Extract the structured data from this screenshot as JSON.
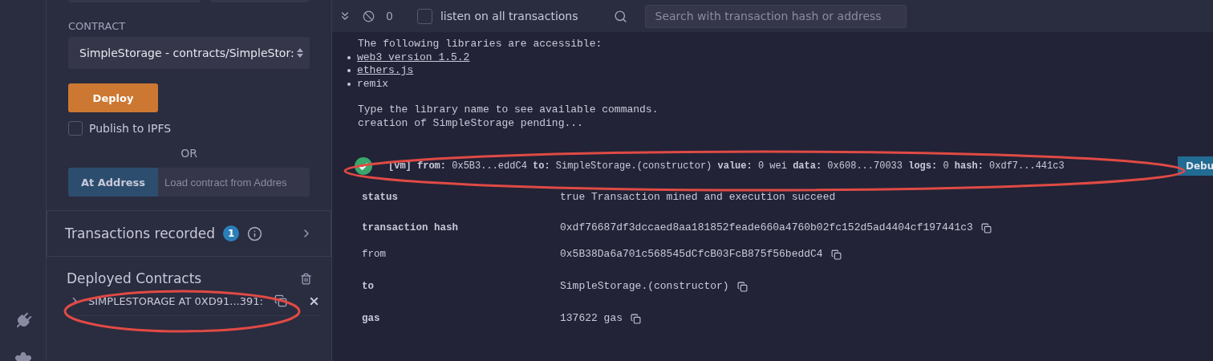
{
  "panel": {
    "contract_label": "CONTRACT",
    "contract_select": "SimpleStorage - contracts/SimpleStor:",
    "deploy_button": "Deploy",
    "publish_checkbox": {
      "label": "Publish to IPFS",
      "checked": false
    },
    "or_label": "OR",
    "at_address_button": "At Address",
    "address_field": {
      "placeholder": "Load contract from Addres"
    },
    "transactions": {
      "title": "Transactions recorded",
      "count": "1"
    },
    "deployed": {
      "title": "Deployed Contracts",
      "instances": [
        {
          "name": "SIMPLESTORAGE AT 0XD91...391:",
          "expanded": false
        }
      ]
    }
  },
  "terminal": {
    "toolbar": {
      "count": "0",
      "listen_checkbox": {
        "label": "listen on all transactions",
        "checked": false
      },
      "search": {
        "placeholder": "Search with transaction hash or address"
      }
    },
    "intro": "The following libraries are accessible:",
    "libraries": [
      {
        "name": "web3 version 1.5.2",
        "link": true
      },
      {
        "name": "ethers.js",
        "link": true
      },
      {
        "name": "remix",
        "link": false
      }
    ],
    "lines": [
      "Type the library name to see available commands.",
      "creation of SimpleStorage pending..."
    ],
    "transaction": {
      "summary": "**[vm]** **from:** 0x5B3...eddC4 **to:** SimpleStorage.(constructor) **value:** 0 wei **data:** 0x608...70033 **logs:** 0 **hash:** 0xdf7...441c3",
      "debug_button": "Debu",
      "details": [
        {
          "key": "status",
          "value": "true Transaction mined and execution succeed",
          "bold": true,
          "copyable": false
        },
        {
          "key": "transaction hash",
          "value": "0xdf76687df3dccaed8aa181852feade660a4760b02fc152d5ad4404cf197441c3",
          "bold": true,
          "copyable": true
        },
        {
          "key": "from",
          "value": "0x5B38Da6a701c568545dCfcB03FcB875f56beddC4",
          "bold": false,
          "copyable": true
        },
        {
          "key": "to",
          "value": "SimpleStorage.(constructor)",
          "bold": true,
          "copyable": true
        },
        {
          "key": "gas",
          "value": "137622 gas",
          "bold": true,
          "copyable": true
        }
      ]
    }
  }
}
